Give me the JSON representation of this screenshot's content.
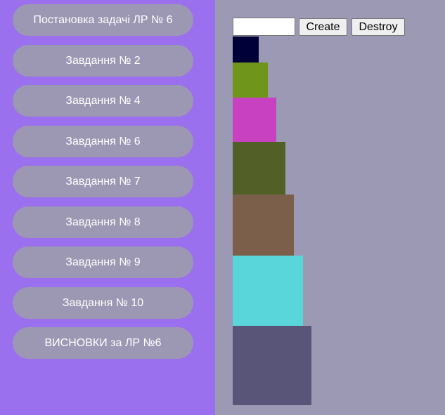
{
  "sidebar": {
    "items": [
      {
        "label": "Постановка задачі ЛР № 6"
      },
      {
        "label": "Завдання № 2"
      },
      {
        "label": "Завдання № 4"
      },
      {
        "label": "Завдання № 6"
      },
      {
        "label": "Завдання № 7"
      },
      {
        "label": "Завдання № 8"
      },
      {
        "label": "Завдання № 9"
      },
      {
        "label": "Завдання № 10"
      },
      {
        "label": "ВИСНОВКИ за ЛР №6"
      }
    ]
  },
  "controls": {
    "input_value": "",
    "create_label": "Create",
    "destroy_label": "Destroy"
  },
  "blocks": [
    {
      "color": "#000038"
    },
    {
      "color": "#6f961b"
    },
    {
      "color": "#c741c0"
    },
    {
      "color": "#526027"
    },
    {
      "color": "#7c5f4a"
    },
    {
      "color": "#59d6d9"
    },
    {
      "color": "#595578"
    }
  ]
}
